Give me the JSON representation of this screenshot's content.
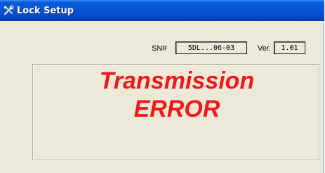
{
  "window": {
    "title": "Lock Setup",
    "icon": "tools-icon"
  },
  "device": {
    "sn_label": "SN#",
    "sn_value": "5DL...06-03",
    "ver_label": "Ver.",
    "ver_value": "1.01"
  },
  "message": {
    "line1": "Transmission",
    "line2": "ERROR",
    "color": "#f01818"
  },
  "colors": {
    "titlebar": "#0553d6",
    "window_bg": "#ece9d8"
  }
}
